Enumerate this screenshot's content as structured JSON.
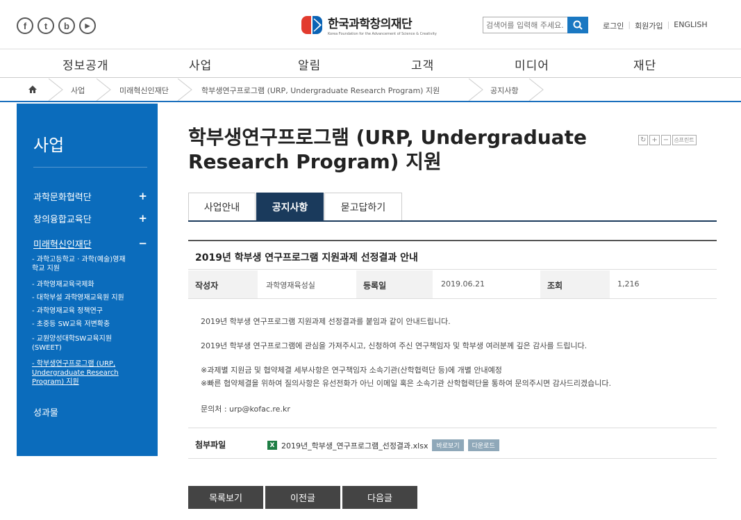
{
  "social": [
    "f",
    "t",
    "b",
    "▶"
  ],
  "logo": {
    "name": "한국과학창의재단",
    "sub": "Korea Foundation for the Advancement of Science & Creativity"
  },
  "search": {
    "placeholder": "검색어를 입력해 주세요."
  },
  "util": {
    "login": "로그인",
    "join": "회원가입",
    "english": "ENGLISH"
  },
  "gnb": [
    "정보공개",
    "사업",
    "알림",
    "고객",
    "미디어",
    "재단"
  ],
  "breadcrumb": [
    "사업",
    "미래혁신인재단",
    "학부생연구프로그램 (URP, Undergraduate Research Program) 지원",
    "공지사항"
  ],
  "sidebar": {
    "title": "사업",
    "menus": [
      {
        "label": "과학문화협력단",
        "sign": "+"
      },
      {
        "label": "창의융합교육단",
        "sign": "+"
      },
      {
        "label": "미래혁신인재단",
        "sign": "−"
      }
    ],
    "subs": [
      "- 과학고등학교 · 과학(예술)영재\n  학교 지원",
      "- 과학영재교육국제화",
      "- 대학부설 과학영재교육원 지원",
      "- 과학영재교육 정책연구",
      "- 초중등 SW교육 저변확충",
      "- 교원양성대학SW교육지원\n  (SWEET)",
      "- 학부생연구프로그램 (URP,\n  Undergraduate Research\n  Program) 지원"
    ],
    "last": "성과물"
  },
  "page_title": "학부생연구프로그램 (URP, Undergraduate Research Program) 지원",
  "tools": {
    "print": "프린트"
  },
  "tabs": [
    "사업안내",
    "공지사항",
    "묻고답하기"
  ],
  "post": {
    "title": "2019년 학부생 연구프로그램 지원과제 선정결과 안내",
    "author_label": "작성자",
    "author": "과학영재육성실",
    "date_label": "등록일",
    "date": "2019.06.21",
    "views_label": "조회",
    "views": "1,216",
    "body": [
      "2019년 학부생 연구프로그램 지원과제 선정결과를 붙임과 같이 안내드립니다.",
      "2019년 학부생 연구프로그램에 관심을 가져주시고, 신청하여 주신 연구책임자 및 학부생 여러분께 깊은 감사를 드립니다.",
      "※과제별 지원금 및 협약체결 세부사항은 연구책임자 소속기관(산학협력단 등)에 개별 안내예정",
      "※빠른 협약체결을 위하여 질의사항은 유선전화가 아닌 이메일 혹은 소속기관 산학협력단을 통하여 문의주시면 감사드리겠습니다.",
      "문의처 : urp@kofac.re.kr"
    ],
    "attach_label": "첨부파일",
    "file": "2019년_학부생_연구프로그램_선정결과.xlsx",
    "view_btn": "바로보기",
    "download_btn": "다운로드"
  },
  "nav": {
    "list": "목록보기",
    "prev": "이전글",
    "next": "다음글"
  }
}
